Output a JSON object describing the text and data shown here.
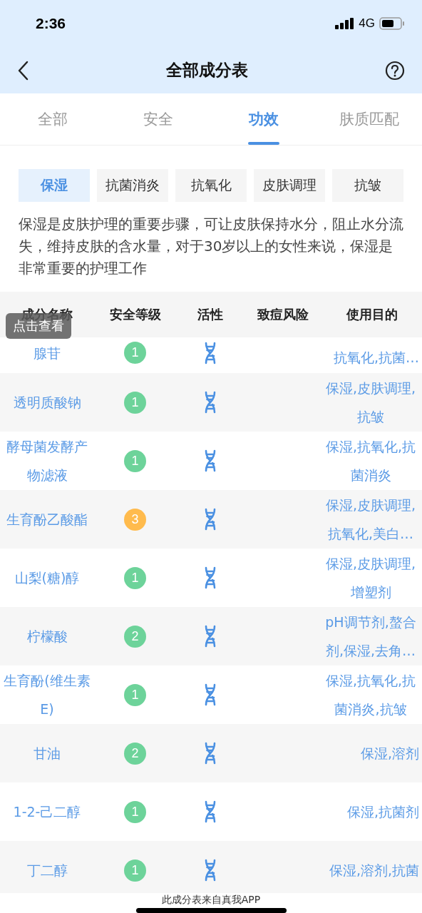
{
  "status_bar": {
    "time": "2:36",
    "network": "4G"
  },
  "nav": {
    "title": "全部成分表"
  },
  "tabs": [
    {
      "label": "全部",
      "selected": false
    },
    {
      "label": "安全",
      "selected": false
    },
    {
      "label": "功效",
      "selected": true
    },
    {
      "label": "肤质匹配",
      "selected": false
    }
  ],
  "chips": [
    {
      "label": "保湿",
      "selected": true
    },
    {
      "label": "抗菌消炎",
      "selected": false
    },
    {
      "label": "抗氧化",
      "selected": false
    },
    {
      "label": "皮肤调理",
      "selected": false
    },
    {
      "label": "抗皱",
      "selected": false
    }
  ],
  "description": "保湿是皮肤护理的重要步骤，可让皮肤保持水分，阻止水分流失，维持皮肤的含水量，对于30岁以上的女性来说，保湿是非常重要的护理工作",
  "table": {
    "columns": [
      "成分名称",
      "安全等级",
      "活性",
      "致痘风险",
      "使用目的"
    ],
    "rows": [
      {
        "kind": "partial",
        "name": "腺苷",
        "level": "1",
        "color": "#6dd39a",
        "purpose": "抗氧化,抗菌…"
      },
      {
        "kind": "full",
        "name": "透明质酸钠",
        "level": "1",
        "color": "#6dd39a",
        "purpose": "保湿,皮肤调理,抗皱"
      },
      {
        "kind": "full",
        "name": "酵母菌发酵产物滤液",
        "level": "1",
        "color": "#6dd39a",
        "purpose": "保湿,抗氧化,抗菌消炎"
      },
      {
        "kind": "full",
        "name": "生育酚乙酸酯",
        "level": "3",
        "color": "#ffbb4d",
        "purpose": "保湿,皮肤调理,抗氧化,美白…"
      },
      {
        "kind": "full",
        "name": "山梨(糖)醇",
        "level": "1",
        "color": "#6dd39a",
        "purpose": "保湿,皮肤调理,增塑剂"
      },
      {
        "kind": "full",
        "name": "柠檬酸",
        "level": "2",
        "color": "#6dd39a",
        "purpose": "pH调节剂,螯合剂,保湿,去角…"
      },
      {
        "kind": "full",
        "name": "生育酚(维生素E)",
        "level": "1",
        "color": "#6dd39a",
        "purpose": "保湿,抗氧化,抗菌消炎,抗皱"
      },
      {
        "kind": "full",
        "name": "甘油",
        "level": "2",
        "color": "#6dd39a",
        "purpose": "保湿,溶剂"
      },
      {
        "kind": "full",
        "name": "1-2-己二醇",
        "level": "1",
        "color": "#6dd39a",
        "purpose": "保湿,抗菌剂"
      },
      {
        "kind": "cut",
        "name": "丁二醇",
        "level": "1",
        "color": "#6dd39a",
        "purpose": "保湿,溶剂,抗菌"
      }
    ]
  },
  "tooltip": "点击查看",
  "footer": "此成分表来自真我APP"
}
